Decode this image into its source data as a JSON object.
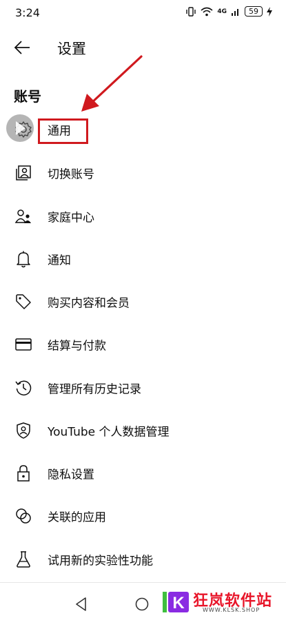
{
  "status_bar": {
    "time": "3:24",
    "signal_text": "4G",
    "battery": "59"
  },
  "header": {
    "title": "设置"
  },
  "section": {
    "title": "账号"
  },
  "menu": {
    "items": [
      {
        "label": "通用",
        "icon": "gear-icon"
      },
      {
        "label": "切换账号",
        "icon": "account-switch-icon"
      },
      {
        "label": "家庭中心",
        "icon": "family-icon"
      },
      {
        "label": "通知",
        "icon": "bell-icon"
      },
      {
        "label": "购买内容和会员",
        "icon": "tag-icon"
      },
      {
        "label": "结算与付款",
        "icon": "credit-card-icon"
      },
      {
        "label": "管理所有历史记录",
        "icon": "history-icon"
      },
      {
        "label": "YouTube 个人数据管理",
        "icon": "shield-person-icon"
      },
      {
        "label": "隐私设置",
        "icon": "lock-icon"
      },
      {
        "label": "关联的应用",
        "icon": "linked-apps-icon"
      },
      {
        "label": "试用新的实验性功能",
        "icon": "flask-icon"
      }
    ]
  },
  "annotation": {
    "highlight_color": "#d0191e"
  },
  "watermark": {
    "brand": "狂岚软件站",
    "url": "WWW.KLSK.SHOP",
    "logo_letter": "K"
  }
}
